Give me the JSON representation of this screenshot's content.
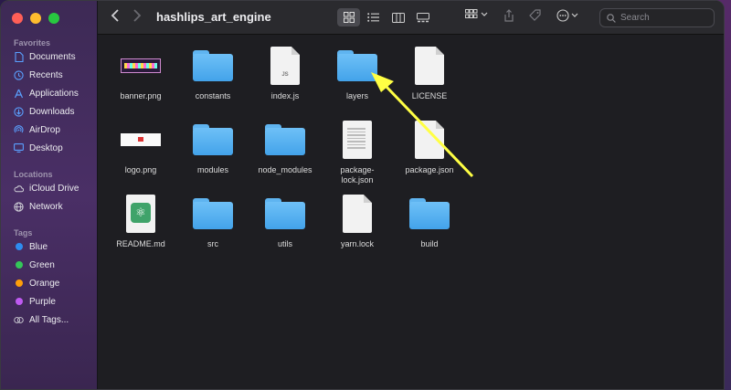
{
  "window": {
    "title": "hashlips_art_engine"
  },
  "sidebar": {
    "favorites_title": "Favorites",
    "favorites": [
      {
        "label": "Documents"
      },
      {
        "label": "Recents"
      },
      {
        "label": "Applications"
      },
      {
        "label": "Downloads"
      },
      {
        "label": "AirDrop"
      },
      {
        "label": "Desktop"
      }
    ],
    "locations_title": "Locations",
    "locations": [
      {
        "label": "iCloud Drive"
      },
      {
        "label": "Network"
      }
    ],
    "tags_title": "Tags",
    "tags": [
      {
        "label": "Blue",
        "color": "#2e8cf0"
      },
      {
        "label": "Green",
        "color": "#34c759"
      },
      {
        "label": "Orange",
        "color": "#ff9f0a"
      },
      {
        "label": "Purple",
        "color": "#bf5af2"
      },
      {
        "label": "All Tags..."
      }
    ]
  },
  "toolbar": {
    "search_placeholder": "Search"
  },
  "files": [
    {
      "name": "banner.png"
    },
    {
      "name": "constants"
    },
    {
      "name": "index.js",
      "badge": "JS"
    },
    {
      "name": "layers"
    },
    {
      "name": "LICENSE"
    },
    {
      "name": "logo.png"
    },
    {
      "name": "modules"
    },
    {
      "name": "node_modules"
    },
    {
      "name": "package-lock.json"
    },
    {
      "name": "package.json"
    },
    {
      "name": "README.md"
    },
    {
      "name": "src"
    },
    {
      "name": "utils"
    },
    {
      "name": "yarn.lock"
    },
    {
      "name": "build"
    }
  ],
  "annotation": {
    "arrow_color": "#ffff44"
  }
}
